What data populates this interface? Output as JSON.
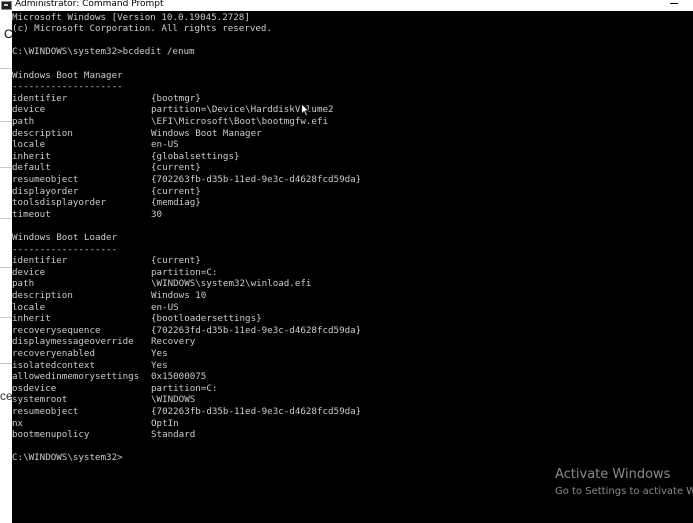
{
  "window": {
    "title": "Administrator: Command Prompt"
  },
  "left_window": {
    "glyph_top": "C",
    "glyph_bottom": "ce"
  },
  "console": {
    "header": [
      "Microsoft Windows [Version 10.0.19045.2728]",
      "(c) Microsoft Corporation. All rights reserved."
    ],
    "command": "C:\\WINDOWS\\system32>bcdedit /enum",
    "sections": [
      {
        "heading": "Windows Boot Manager",
        "underline": "--------------------",
        "entries": [
          {
            "key": "identifier",
            "value": "{bootmgr}"
          },
          {
            "key": "device",
            "value": "partition=\\Device\\HarddiskVolume2"
          },
          {
            "key": "path",
            "value": "\\EFI\\Microsoft\\Boot\\bootmgfw.efi"
          },
          {
            "key": "description",
            "value": "Windows Boot Manager"
          },
          {
            "key": "locale",
            "value": "en-US"
          },
          {
            "key": "inherit",
            "value": "{globalsettings}"
          },
          {
            "key": "default",
            "value": "{current}"
          },
          {
            "key": "resumeobject",
            "value": "{702263fb-d35b-11ed-9e3c-d4628fcd59da}"
          },
          {
            "key": "displayorder",
            "value": "{current}"
          },
          {
            "key": "toolsdisplayorder",
            "value": "{memdiag}"
          },
          {
            "key": "timeout",
            "value": "30"
          }
        ]
      },
      {
        "heading": "Windows Boot Loader",
        "underline": "-------------------",
        "entries": [
          {
            "key": "identifier",
            "value": "{current}"
          },
          {
            "key": "device",
            "value": "partition=C:"
          },
          {
            "key": "path",
            "value": "\\WINDOWS\\system32\\winload.efi"
          },
          {
            "key": "description",
            "value": "Windows 10"
          },
          {
            "key": "locale",
            "value": "en-US"
          },
          {
            "key": "inherit",
            "value": "{bootloadersettings}"
          },
          {
            "key": "recoverysequence",
            "value": "{702263fd-d35b-11ed-9e3c-d4628fcd59da}"
          },
          {
            "key": "displaymessageoverride",
            "value": "Recovery"
          },
          {
            "key": "recoveryenabled",
            "value": "Yes"
          },
          {
            "key": "isolatedcontext",
            "value": "Yes"
          },
          {
            "key": "allowedinmemorysettings",
            "value": "0x15000075"
          },
          {
            "key": "osdevice",
            "value": "partition=C:"
          },
          {
            "key": "systemroot",
            "value": "\\WINDOWS"
          },
          {
            "key": "resumeobject",
            "value": "{702263fb-d35b-11ed-9e3c-d4628fcd59da}"
          },
          {
            "key": "nx",
            "value": "OptIn"
          },
          {
            "key": "bootmenupolicy",
            "value": "Standard"
          }
        ]
      }
    ],
    "prompt": "C:\\WINDOWS\\system32>"
  },
  "watermark": {
    "title": "Activate Windows",
    "subtitle": "Go to Settings to activate Wi"
  },
  "colors": {
    "console_bg": "#000000",
    "console_text": "#cccccc",
    "titlebar_bg": "#ffffff",
    "watermark_text": "#8a8a8a"
  },
  "icons": {
    "title_icon": "command-prompt-icon",
    "pointer": "mouse-cursor-icon"
  }
}
